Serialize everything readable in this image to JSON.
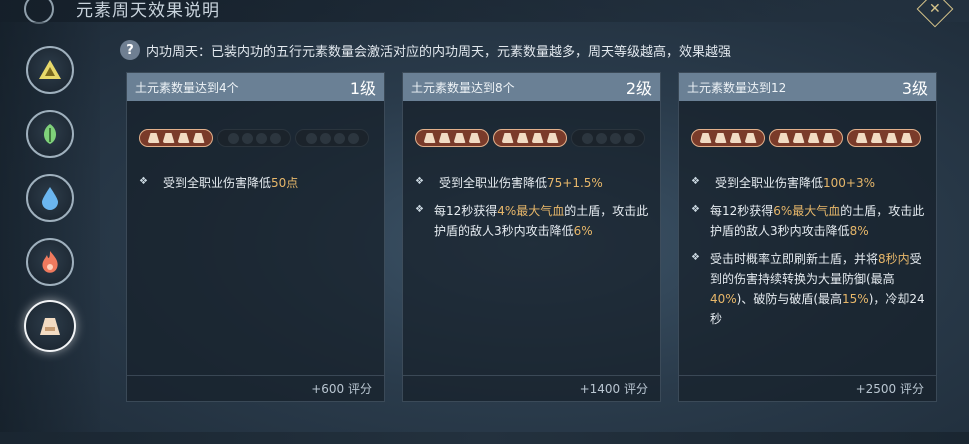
{
  "window": {
    "title": "元素周天效果说明",
    "close_label": "✕"
  },
  "description": "内功周天：已装内功的五行元素数量会激活对应的内功周天，元素数量越多，周天等级越高，效果越强",
  "sidebar": {
    "items": [
      {
        "name": "element-metal",
        "color": "#e8d96a",
        "active": false
      },
      {
        "name": "element-wood",
        "color": "#7fd17a",
        "active": false
      },
      {
        "name": "element-water",
        "color": "#6bb6f0",
        "active": false
      },
      {
        "name": "element-fire",
        "color": "#f07a5e",
        "active": false
      },
      {
        "name": "element-earth",
        "color": "#f3dcc3",
        "active": true
      }
    ]
  },
  "cards": [
    {
      "condition": "土元素数量达到4个",
      "level": "1级",
      "badges_on": 1,
      "effects": [
        {
          "segments": [
            "受到全职业伤害降低",
            "50点"
          ],
          "hl": [
            1
          ]
        }
      ],
      "score": "+600 评分"
    },
    {
      "condition": "土元素数量达到8个",
      "level": "2级",
      "badges_on": 2,
      "effects": [
        {
          "segments": [
            "受到全职业伤害降低",
            "75+1.5%"
          ],
          "hl": [
            1
          ]
        },
        {
          "segments": [
            "每12秒获得",
            "4%最大气血",
            "的土盾，攻击此护盾的敌人3秒内攻击降低",
            "6%"
          ],
          "hl": [
            1,
            3
          ]
        }
      ],
      "score": "+1400 评分"
    },
    {
      "condition": "土元素数量达到12",
      "level": "3级",
      "badges_on": 3,
      "effects": [
        {
          "segments": [
            "受到全职业伤害降低",
            "100+3%"
          ],
          "hl": [
            1
          ]
        },
        {
          "segments": [
            "每12秒获得",
            "6%最大气血",
            "的土盾，攻击此护盾的敌人3秒内攻击降低",
            "8%"
          ],
          "hl": [
            1,
            3
          ]
        },
        {
          "segments": [
            "受击时概率立即刷新土盾，并将",
            "8秒内",
            "受到的伤害持续转换为大量防御(最高",
            "40%",
            ")、破防与破盾(最高",
            "15%",
            ")，冷却24秒"
          ],
          "hl": [
            1,
            3,
            5
          ]
        }
      ],
      "score": "+2500 评分"
    }
  ]
}
